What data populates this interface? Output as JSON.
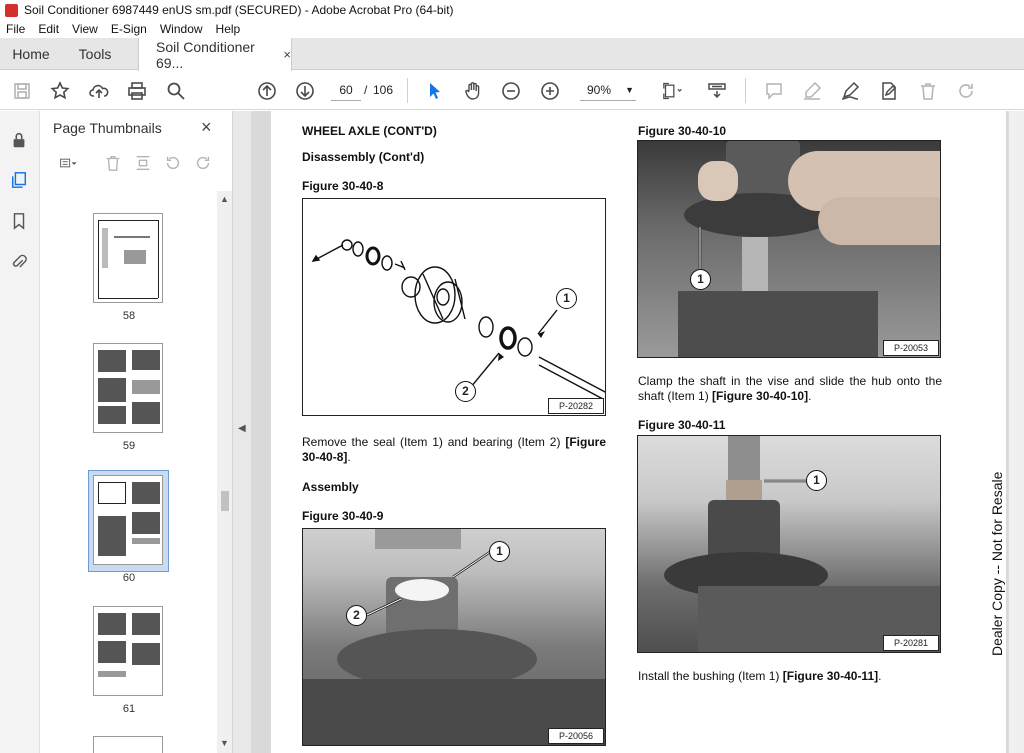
{
  "window": {
    "title": "Soil Conditioner 6987449 enUS sm.pdf (SECURED) - Adobe Acrobat Pro (64-bit)"
  },
  "menu": [
    "File",
    "Edit",
    "View",
    "E-Sign",
    "Window",
    "Help"
  ],
  "tabs": {
    "home": "Home",
    "tools": "Tools",
    "doc": "Soil Conditioner 69...",
    "close": "×"
  },
  "toolbar": {
    "page_current": "60",
    "page_sep": "/",
    "page_total": "106",
    "zoom": "90%"
  },
  "panel": {
    "title": "Page Thumbnails",
    "close": "×",
    "thumbs": [
      {
        "label": "58"
      },
      {
        "label": "59"
      },
      {
        "label": "60"
      },
      {
        "label": "61"
      }
    ]
  },
  "page": {
    "heading": "WHEEL AXLE (CONT'D)",
    "subheading": "Disassembly (Cont'd)",
    "fig8_label": "Figure 30-40-8",
    "fig8_code": "P-20282",
    "remove_text_plain": "Remove the seal (Item 1) and bearing (Item 2) ",
    "remove_text_bold": "[Figure 30-40-8]",
    "remove_text_end": ".",
    "assembly": "Assembly",
    "fig9_label": "Figure 30-40-9",
    "fig9_code": "P-20056",
    "fig10_label": "Figure 30-40-10",
    "fig10_code": "P-20053",
    "clamp_text_plain": "Clamp the shaft in the vise and slide the hub onto the shaft (Item 1) ",
    "clamp_text_bold": "[Figure 30-40-10]",
    "clamp_text_end": ".",
    "fig11_label": "Figure 30-40-11",
    "fig11_code": "P-20281",
    "install_text_plain": "Install the bushing (Item 1) ",
    "install_text_bold": "[Figure 30-40-11]",
    "install_text_end": ".",
    "callout_1": "1",
    "callout_2": "2",
    "watermark": "Dealer Copy -- Not for Resale"
  }
}
